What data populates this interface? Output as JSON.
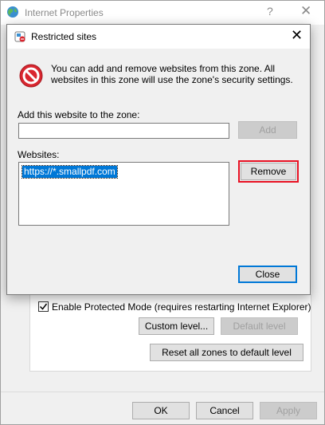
{
  "outer_window": {
    "title": "Internet Properties",
    "help_glyph": "?",
    "close_glyph": "✕",
    "enable_protected_mode": {
      "label": "Enable Protected Mode (requires restarting Internet Explorer)",
      "checked": true
    },
    "custom_level_button": "Custom level...",
    "default_level_button": "Default level",
    "reset_all_zones_button": "Reset all zones to default level",
    "ok_button": "OK",
    "cancel_button": "Cancel",
    "apply_button": "Apply"
  },
  "dialog": {
    "title": "Restricted sites",
    "close_glyph": "✕",
    "info_text": "You can add and remove websites from this zone. All websites in this zone will use the zone's security settings.",
    "add_label": "Add this website to the zone:",
    "add_input_value": "",
    "add_button": "Add",
    "websites_label": "Websites:",
    "websites": [
      "https://*.smallpdf.com"
    ],
    "remove_button": "Remove",
    "close_button": "Close"
  },
  "colors": {
    "selection": "#0078d7",
    "highlight_border": "#e81123",
    "stop_icon": "#d9262f"
  },
  "icons": {
    "window_icon": "globe-icon",
    "dialog_icon": "restricted-sites-icon",
    "info_icon": "stop-icon"
  }
}
